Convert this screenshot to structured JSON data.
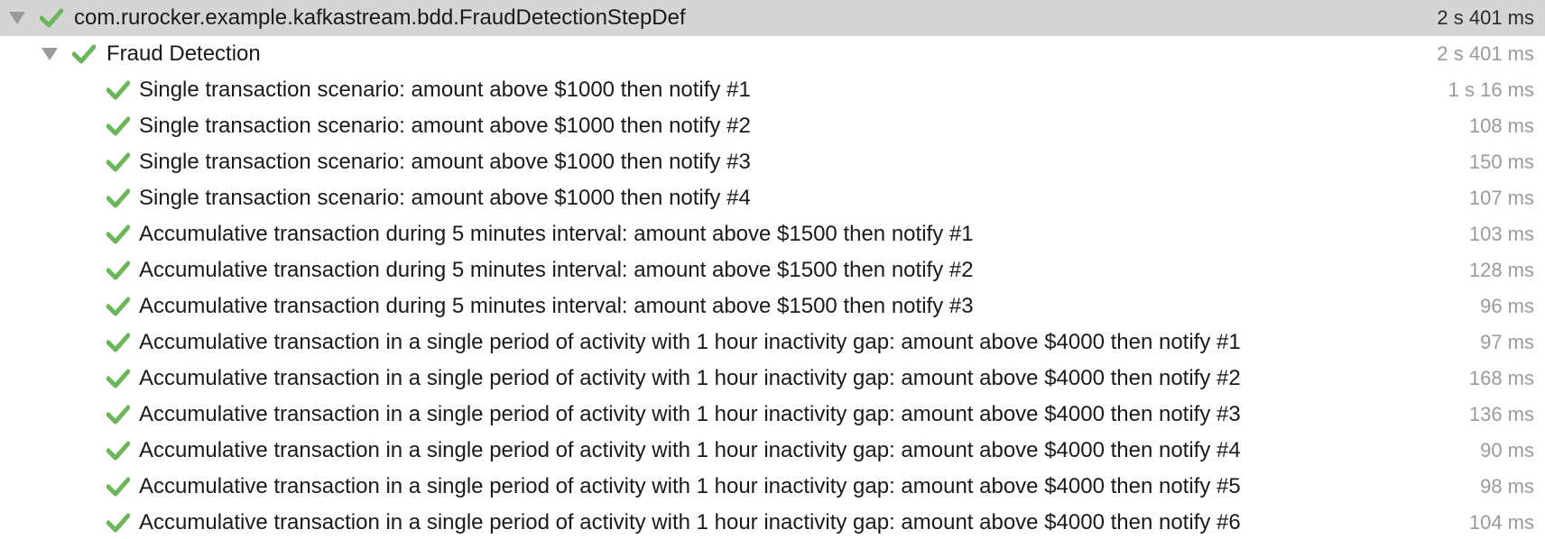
{
  "test_tree": {
    "root": {
      "label": "com.rurocker.example.kafkastream.bdd.FraudDetectionStepDef",
      "duration": "2 s 401 ms",
      "status": "passed",
      "expanded": true
    },
    "feature": {
      "label": "Fraud Detection",
      "duration": "2 s 401 ms",
      "status": "passed",
      "expanded": true
    },
    "scenarios": [
      {
        "label": "Single transaction scenario: amount above $1000 then notify #1",
        "duration": "1 s 16 ms",
        "status": "passed"
      },
      {
        "label": "Single transaction scenario: amount above $1000 then notify #2",
        "duration": "108 ms",
        "status": "passed"
      },
      {
        "label": "Single transaction scenario: amount above $1000 then notify #3",
        "duration": "150 ms",
        "status": "passed"
      },
      {
        "label": "Single transaction scenario: amount above $1000 then notify #4",
        "duration": "107 ms",
        "status": "passed"
      },
      {
        "label": "Accumulative transaction during 5 minutes interval: amount above $1500 then notify #1",
        "duration": "103 ms",
        "status": "passed"
      },
      {
        "label": "Accumulative transaction during 5 minutes interval: amount above $1500 then notify #2",
        "duration": "128 ms",
        "status": "passed"
      },
      {
        "label": "Accumulative transaction during 5 minutes interval: amount above $1500 then notify #3",
        "duration": "96 ms",
        "status": "passed"
      },
      {
        "label": "Accumulative transaction in a single period of activity with 1 hour inactivity gap: amount above $4000 then notify #1",
        "duration": "97 ms",
        "status": "passed"
      },
      {
        "label": "Accumulative transaction in a single period of activity with 1 hour inactivity gap: amount above $4000 then notify #2",
        "duration": "168 ms",
        "status": "passed"
      },
      {
        "label": "Accumulative transaction in a single period of activity with 1 hour inactivity gap: amount above $4000 then notify #3",
        "duration": "136 ms",
        "status": "passed"
      },
      {
        "label": "Accumulative transaction in a single period of activity with 1 hour inactivity gap: amount above $4000 then notify #4",
        "duration": "90 ms",
        "status": "passed"
      },
      {
        "label": "Accumulative transaction in a single period of activity with 1 hour inactivity gap: amount above $4000 then notify #5",
        "duration": "98 ms",
        "status": "passed"
      },
      {
        "label": "Accumulative transaction in a single period of activity with 1 hour inactivity gap: amount above $4000 then notify #6",
        "duration": "104 ms",
        "status": "passed"
      }
    ]
  },
  "colors": {
    "pass": "#6ab75a",
    "selected_row": "#d5d5d5",
    "duration_text": "#9a9a9a",
    "toggle": "#9b9b9b"
  },
  "icons": {
    "status_passed": "check-icon",
    "expand_toggle": "triangle-down-icon"
  }
}
